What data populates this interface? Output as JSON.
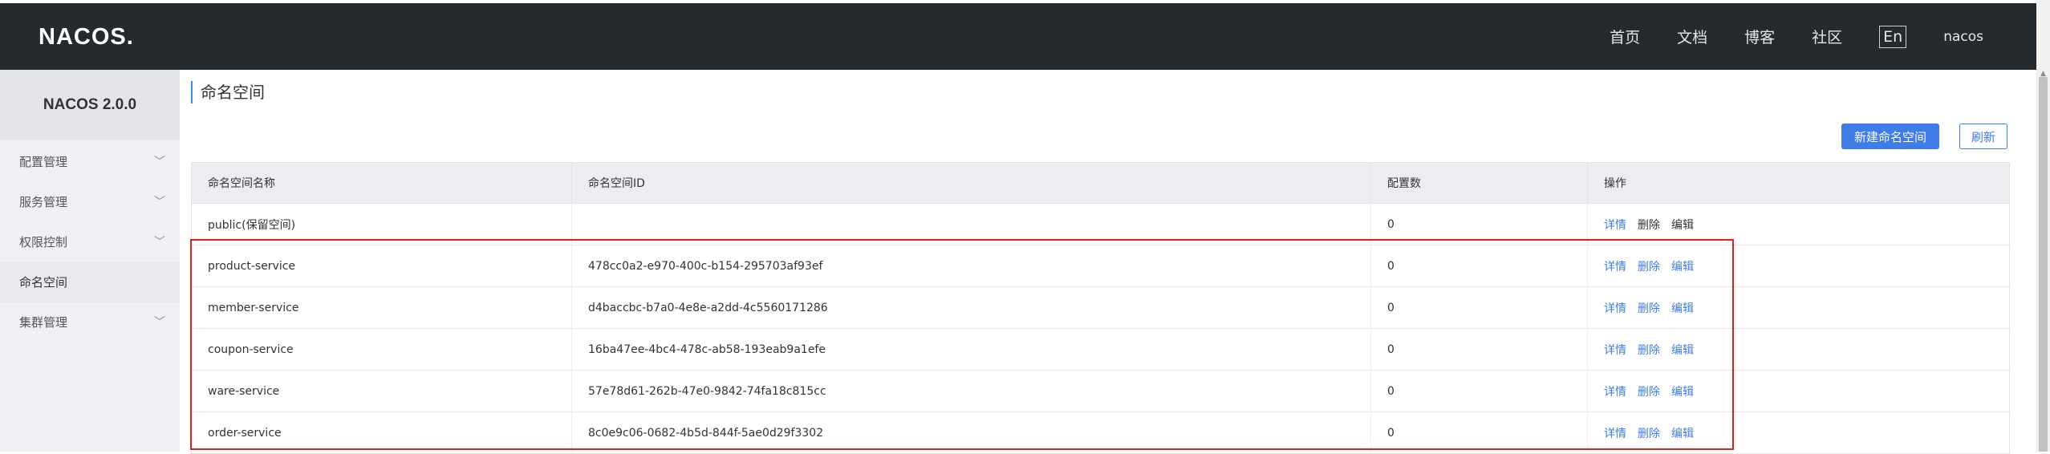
{
  "header": {
    "logo": "NACOS.",
    "nav": [
      "首页",
      "文档",
      "博客",
      "社区"
    ],
    "lang": "En",
    "user": "nacos"
  },
  "sidebar": {
    "version": "NACOS 2.0.0",
    "items": [
      {
        "label": "配置管理",
        "expandable": true
      },
      {
        "label": "服务管理",
        "expandable": true
      },
      {
        "label": "权限控制",
        "expandable": true
      },
      {
        "label": "命名空间",
        "expandable": false,
        "active": true
      },
      {
        "label": "集群管理",
        "expandable": true
      }
    ]
  },
  "main": {
    "title": "命名空间",
    "new_button": "新建命名空间",
    "refresh_button": "刷新",
    "columns": [
      "命名空间名称",
      "命名空间ID",
      "配置数",
      "操作"
    ],
    "rows": [
      {
        "name": "public(保留空间)",
        "id": "",
        "count": "0",
        "ops": [
          "详情",
          "删除",
          "编辑"
        ]
      },
      {
        "name": "product-service",
        "id": "478cc0a2-e970-400c-b154-295703af93ef",
        "count": "0",
        "ops": [
          "详情",
          "删除",
          "编辑"
        ]
      },
      {
        "name": "member-service",
        "id": "d4baccbc-b7a0-4e8e-a2dd-4c5560171286",
        "count": "0",
        "ops": [
          "详情",
          "删除",
          "编辑"
        ]
      },
      {
        "name": "coupon-service",
        "id": "16ba47ee-4bc4-478c-ab58-193eab9a1efe",
        "count": "0",
        "ops": [
          "详情",
          "删除",
          "编辑"
        ]
      },
      {
        "name": "ware-service",
        "id": "57e78d61-262b-47e0-9842-74fa18c815cc",
        "count": "0",
        "ops": [
          "详情",
          "删除",
          "编辑"
        ]
      },
      {
        "name": "order-service",
        "id": "8c0e9c06-0682-4b5d-844f-5ae0d29f3302",
        "count": "0",
        "ops": [
          "详情",
          "删除",
          "编辑"
        ]
      }
    ]
  },
  "icons": {
    "chevron": "chevron-down-icon"
  },
  "colors": {
    "accent": "#3f7ce8",
    "header_bg": "#252a2f",
    "highlight": "#e02020"
  }
}
